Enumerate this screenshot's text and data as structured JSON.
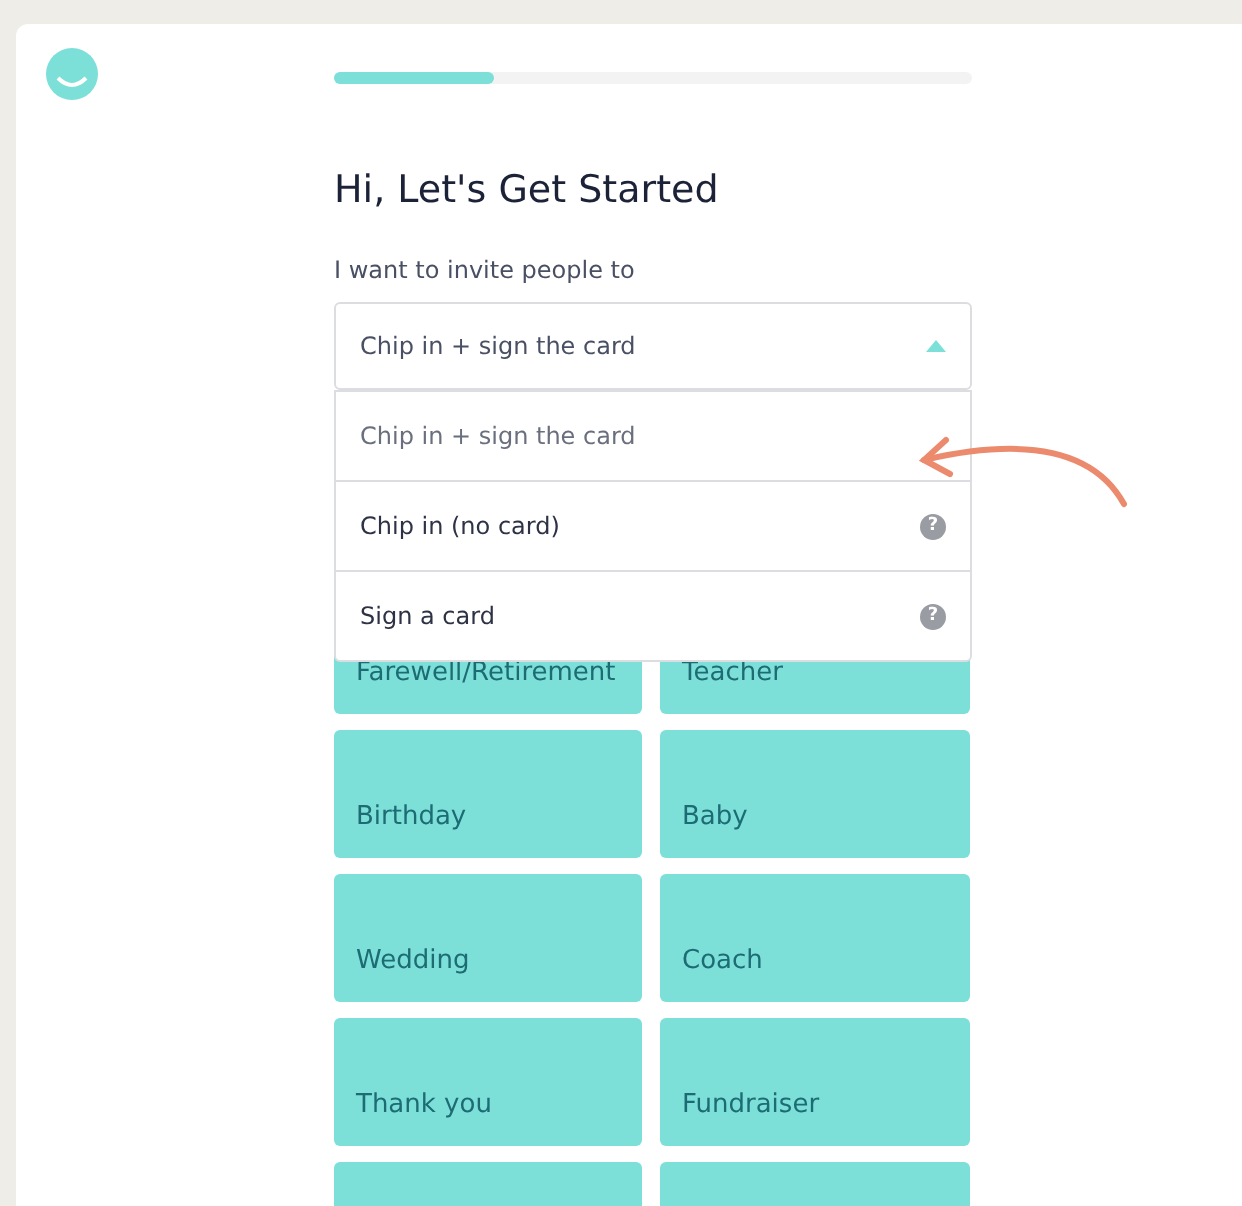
{
  "progress": {
    "level": 0.25
  },
  "heading": "Hi, Let's Get Started",
  "invite": {
    "label": "I want to invite people to",
    "value": "Chip in + sign the card",
    "expanded": true,
    "options": [
      {
        "label": "Chip in + sign the card",
        "selected": true
      },
      {
        "label": "Chip in (no card)",
        "selected": false,
        "help": "?"
      },
      {
        "label": "Sign a card",
        "selected": false,
        "help": "?"
      }
    ]
  },
  "occasions": [
    {
      "kind": "labeled",
      "label": "Farewell/Retirement"
    },
    {
      "kind": "labeled",
      "label": "Teacher"
    },
    {
      "kind": "labeled",
      "label": "Birthday"
    },
    {
      "kind": "labeled",
      "label": "Baby"
    },
    {
      "kind": "labeled",
      "label": "Wedding"
    },
    {
      "kind": "labeled",
      "label": "Coach"
    },
    {
      "kind": "labeled",
      "label": "Thank you"
    },
    {
      "kind": "labeled",
      "label": "Fundraiser"
    },
    {
      "kind": "blank"
    },
    {
      "kind": "blank"
    }
  ]
}
